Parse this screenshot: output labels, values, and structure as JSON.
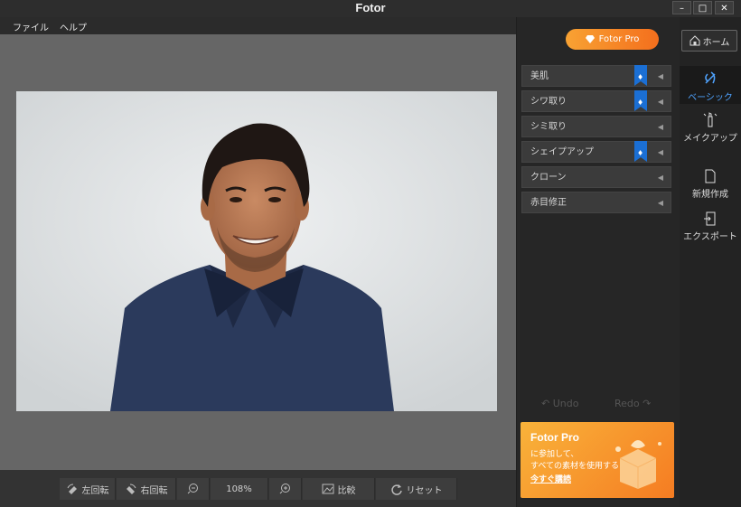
{
  "window": {
    "title": "Fotor",
    "min": "–",
    "max": "□",
    "close": "✕"
  },
  "menu": [
    "ファイル",
    "ヘルプ"
  ],
  "toolbar": {
    "rotate_left": "左回転",
    "rotate_right": "右回転",
    "zoom": "108%",
    "compare": "比較",
    "reset": "リセット"
  },
  "panel": {
    "pro_label": "Fotor Pro",
    "features": [
      {
        "label": "美肌",
        "pro": true
      },
      {
        "label": "シワ取り",
        "pro": true
      },
      {
        "label": "シミ取り",
        "pro": false
      },
      {
        "label": "シェイプアップ",
        "pro": true
      },
      {
        "label": "クローン",
        "pro": false
      },
      {
        "label": "赤目修正",
        "pro": false
      }
    ],
    "undo": "Undo",
    "redo": "Redo",
    "promo": {
      "title": "Fotor Pro",
      "line1": "に参加して、",
      "line2": "すべての素材を使用する",
      "link": "今すぐ購読"
    }
  },
  "rail": {
    "home": "ホーム",
    "basic": "ベーシック",
    "makeup": "メイクアップ",
    "new": "新規作成",
    "export": "エクスポート"
  },
  "colors": {
    "accent": "#f46f1d",
    "active": "#4fa3ff",
    "pro_badge": "#1b6fd4"
  },
  "icons": [
    "rotate-left-icon",
    "rotate-right-icon",
    "zoom-out-icon",
    "zoom-in-icon",
    "compare-icon",
    "reset-icon",
    "diamond-icon",
    "home-icon",
    "basic-icon",
    "makeup-icon",
    "new-file-icon",
    "export-icon",
    "undo-icon",
    "redo-icon"
  ]
}
